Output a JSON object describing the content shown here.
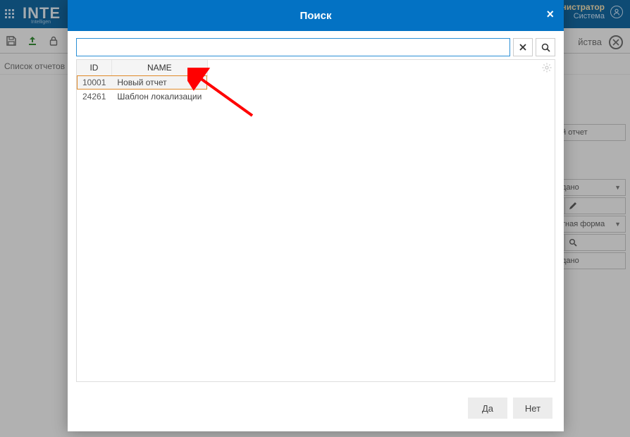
{
  "topbar": {
    "logo_text": "INTE",
    "logo_sub": "Intelligen",
    "admin_label": "министратор",
    "system_label": "Система"
  },
  "breadcrumb": "Список отчетов",
  "properties_label": "йства",
  "right_panel": {
    "field1": "й отчет",
    "field2": "дано",
    "field3": "",
    "field4": "тная форма",
    "field5": "",
    "field6": "дано"
  },
  "modal": {
    "title": "Поиск",
    "search_value": "",
    "search_placeholder": "",
    "columns": {
      "id": "ID",
      "name": "NAME"
    },
    "rows": [
      {
        "id": "10001",
        "name": "Новый отчет",
        "selected": true
      },
      {
        "id": "24261",
        "name": "Шаблон локализации",
        "selected": false
      }
    ],
    "yes_label": "Да",
    "no_label": "Нет"
  }
}
